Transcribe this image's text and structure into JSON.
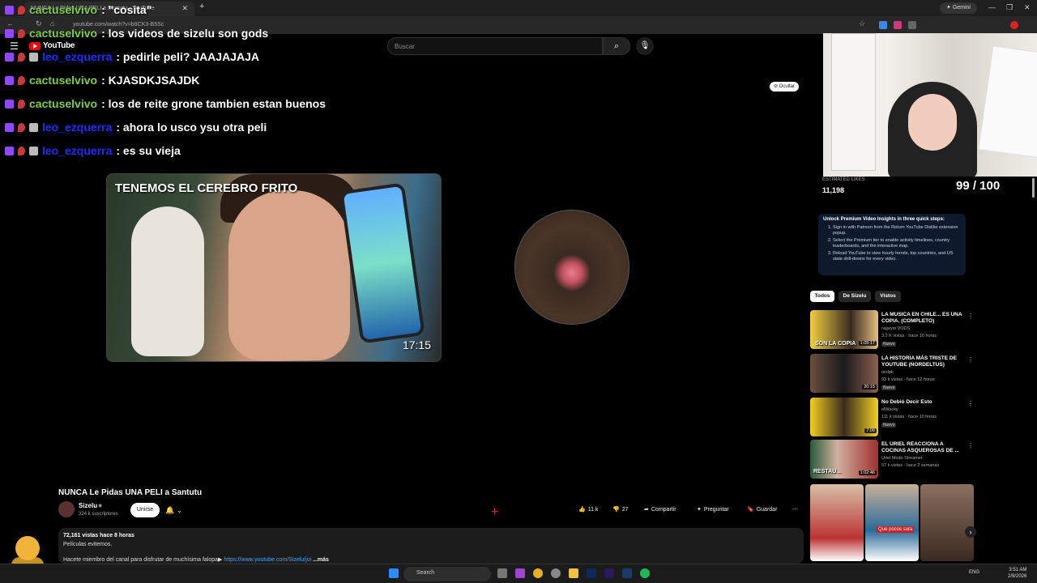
{
  "browser": {
    "tab_title": "NUNCA Le Pidas UNA PELI a Santutu - YouTube",
    "url": "youtube.com/watch?v=b9CK3-B5Sc",
    "gemini_label": "Gemini"
  },
  "youtube": {
    "logo_text": "YouTube",
    "search_placeholder": "Buscar"
  },
  "chat": [
    {
      "user": "cactuselvivo",
      "color": "green",
      "message": ": \"cosita\""
    },
    {
      "user": "cactuselvivo",
      "color": "green",
      "message": ": los videos de sizelu son gods"
    },
    {
      "user": "leo_ezquerra",
      "color": "blue",
      "message": ": pedirle peli? JAAJAJAJA"
    },
    {
      "user": "cactuselvivo",
      "color": "green",
      "message": ": KJASDKJSAJDK"
    },
    {
      "user": "cactuselvivo",
      "color": "green",
      "message": ": los de reite grone tambien estan buenos"
    },
    {
      "user": "leo_ezquerra",
      "color": "blue",
      "message": ": ahora lo usco ysu otra peli"
    },
    {
      "user": "leo_ezquerra",
      "color": "blue",
      "message": ": es su vieja"
    }
  ],
  "player": {
    "thumb_title": "TENEMOS EL CEREBRO FRITO",
    "thumb_duration": "17:15",
    "hide_label": "Ocultar"
  },
  "video": {
    "title": "NUNCA Le Pidas UNA PELI a Santutu",
    "channel": "Sizelu",
    "subscribers": "324 k suscriptores",
    "join_label": "Unirse",
    "likes": "11 k",
    "dislikes": "27",
    "share": "Compartir",
    "ask": "Preguntar",
    "save": "Guardar",
    "stats": "72,161 vistas  hace 8 horas",
    "desc_line1": "Películas evitemos.",
    "desc_line2_pre": "Hacete miembro del canal para disfrutar de muchísima falopa▶ ",
    "desc_link": "https://www.youtube.com/Sizelu/joi",
    "desc_more": " ...más"
  },
  "sidebar": {
    "estimated_likes_label": "ESTIMATED LIKES",
    "estimated_likes": "11,198",
    "score": "99 / 100",
    "premium_title": "Unlock Premium Video Insights in three quick steps:",
    "premium_steps": [
      "Sign in with Patreon from the Return YouTube Dislike extension popup.",
      "Select the Premium tier to enable activity timelines, country leaderboards, and the interactive map.",
      "Reload YouTube to view hourly trends, top countries, and US state drill-downs for every video."
    ],
    "chips": [
      "Todos",
      "De Sizelu",
      "Vistos"
    ],
    "recommendations": [
      {
        "title": "LA MUSICA EN CHILE... ES UNA COPIA. (COMPLETO)",
        "channel": "rageyio VODS",
        "meta": "3.2 K vistas · hace 10 horas",
        "badge": "Nuevo",
        "duration": "1:05:17"
      },
      {
        "title": "LA HISTORIA MÁS TRISTE DE YOUTUBE (NORDELTUS)",
        "channel": "orslok",
        "meta": "93 k vistas · hace 12 horas",
        "badge": "Nuevo",
        "duration": "20:15"
      },
      {
        "title": "No Debió Decir Esto",
        "channel": "elWacky",
        "meta": "111 k vistas · hace 10 horas",
        "badge": "Nuevo",
        "duration": "7:00"
      },
      {
        "title": "EL URIEL REACCIONA A COCINAS ASQUEROSAS DE ...",
        "channel": "Uriel Modo Streamer",
        "meta": "57 k vistas · hace 2 semanas",
        "badge": "",
        "duration": "1:02:46"
      }
    ],
    "thumb_text": [
      "SON LA COPIA",
      "RESTAU..."
    ],
    "short_text": "Qué pocos sura"
  },
  "taskbar": {
    "search": "Search",
    "lang": "ENG",
    "time": "3:51 AM",
    "date": "2/9/2026"
  },
  "colors": {
    "chat_green": "#7ad045",
    "chat_blue": "#1a2cff",
    "yt_red": "#ff0000",
    "link": "#3ea6ff"
  }
}
